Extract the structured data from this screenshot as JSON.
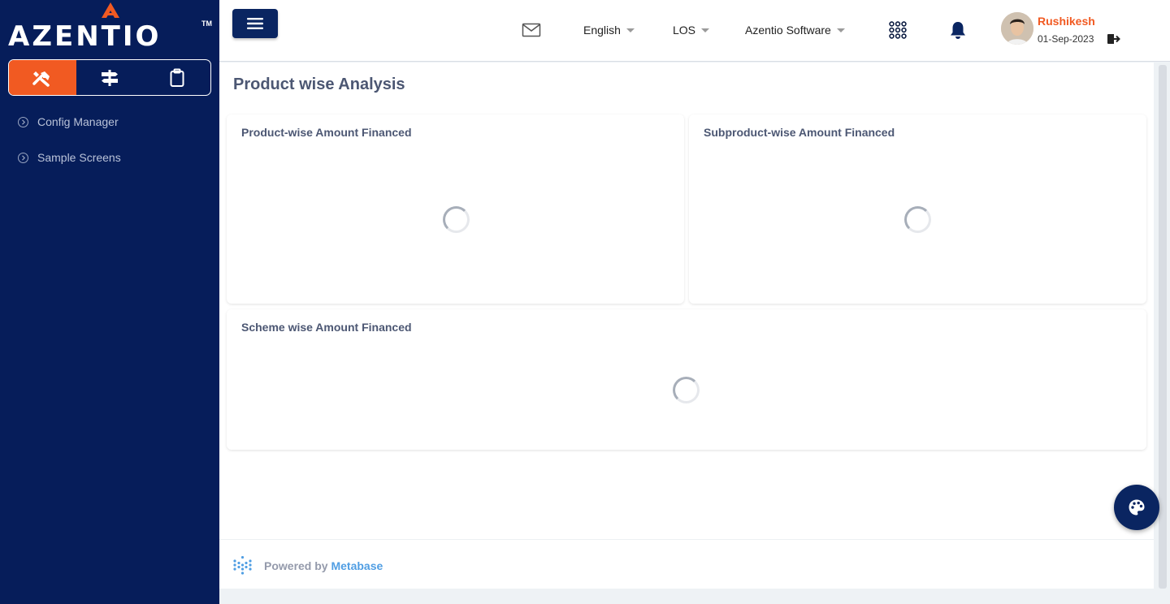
{
  "brand": {
    "logo_text": "AZENTIO",
    "trademark": "TM",
    "accent_color": "#f15a22",
    "sidebar_color": "#061d5a"
  },
  "sidebar": {
    "mode_tabs": [
      {
        "icon": "tools-icon",
        "active": true
      },
      {
        "icon": "signpost-icon",
        "active": false
      },
      {
        "icon": "clipboard-icon",
        "active": false
      }
    ],
    "items": [
      {
        "label": "Config Manager",
        "icon": "chevron-right-circle-icon"
      },
      {
        "label": "Sample Screens",
        "icon": "chevron-right-circle-icon"
      }
    ]
  },
  "header": {
    "menu_icon": "hamburger-icon",
    "mail_icon": "mail-icon",
    "language": "English",
    "module": "LOS",
    "company": "Azentio Software",
    "apps_icon": "apps-grid-icon",
    "notification_icon": "bell-icon",
    "user": {
      "name": "Rushikesh",
      "date": "01-Sep-2023",
      "logout_icon": "logout-icon"
    }
  },
  "main": {
    "title": "Product wise Analysis",
    "cards": [
      {
        "title": "Product-wise Amount Financed",
        "state": "loading"
      },
      {
        "title": "Subproduct-wise Amount Financed",
        "state": "loading"
      },
      {
        "title": "Scheme wise Amount Financed",
        "state": "loading"
      }
    ],
    "footer": {
      "powered_by": "Powered by",
      "brand": "Metabase"
    }
  },
  "fab": {
    "icon": "palette-icon"
  }
}
